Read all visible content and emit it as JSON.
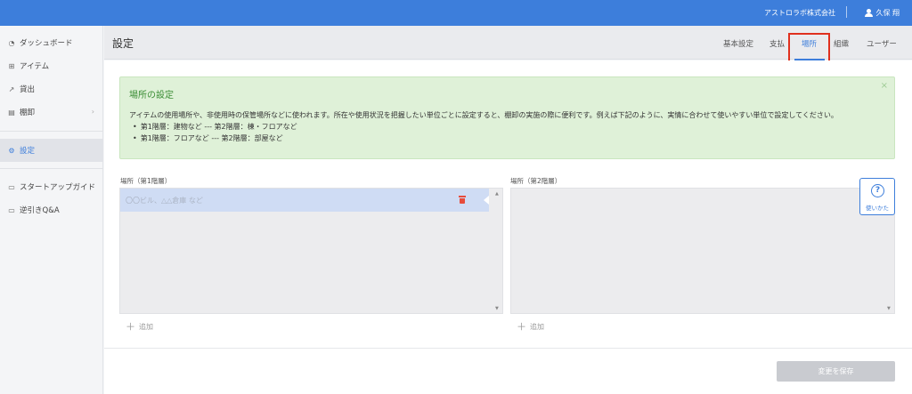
{
  "topbar": {
    "company": "アストロラボ株式会社",
    "user_name": "久保 翔"
  },
  "sidebar": {
    "items": [
      {
        "label": "ダッシュボード",
        "icon": "gauge-icon"
      },
      {
        "label": "アイテム",
        "icon": "box-icon"
      },
      {
        "label": "貸出",
        "icon": "export-icon"
      },
      {
        "label": "棚卸",
        "icon": "clipboard-icon"
      },
      {
        "label": "設定",
        "icon": "gear-icon"
      },
      {
        "label": "スタートアップガイド",
        "icon": "book-icon"
      },
      {
        "label": "逆引きQ&A",
        "icon": "book-icon"
      }
    ]
  },
  "header": {
    "title": "設定",
    "tabs": [
      {
        "label": "基本設定"
      },
      {
        "label": "支払"
      },
      {
        "label": "場所"
      },
      {
        "label": "組織"
      },
      {
        "label": "ユーザー"
      }
    ],
    "active_tab": "場所"
  },
  "notice": {
    "title": "場所の設定",
    "body": "アイテムの使用場所や、非使用時の保管場所などに使われます。所在や使用状況を把握したい単位ごとに設定すると、棚卸の実施の際に便利です。例えば下記のように、実情に合わせて使いやすい単位で設定してください。",
    "examples": [
      "第1階層：建物など --- 第2階層：棟・フロアなど",
      "第1階層：フロアなど --- 第2階層：部屋など"
    ],
    "close_symbol": "×"
  },
  "level1": {
    "label": "場所（第1階層）",
    "input_placeholder": "〇〇ビル、△△倉庫 など",
    "add_label": "追加"
  },
  "level2": {
    "label": "場所（第2階層）",
    "add_label": "追加"
  },
  "help": {
    "label": "使いかた",
    "symbol": "?"
  },
  "footer": {
    "save_label": "変更を保存"
  },
  "colors": {
    "primary": "#3d7edb",
    "notice_bg": "#dff1d8",
    "notice_title": "#3a8d34",
    "danger": "#e74c3c",
    "highlight": "#e0301e"
  }
}
